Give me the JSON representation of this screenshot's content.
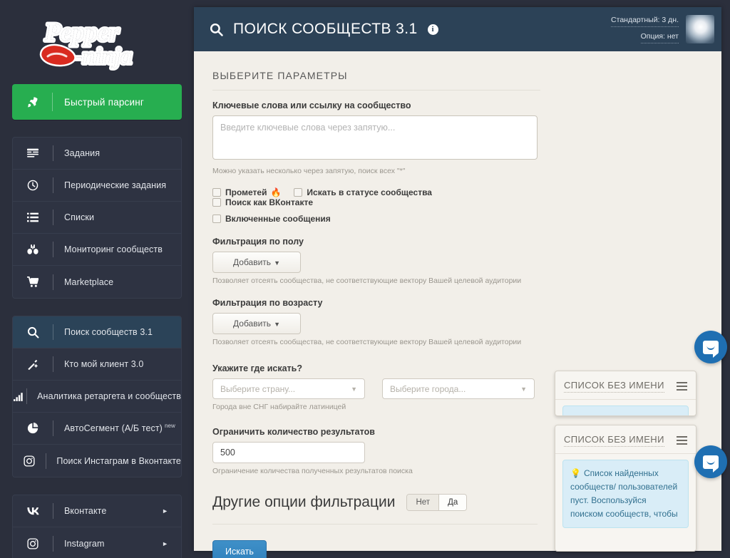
{
  "brand": {
    "logo_line1": "Pepper",
    "logo_line2": "ninja"
  },
  "sidebar": {
    "quick": {
      "label": "Быстрый парсинг",
      "icon": "rocket-icon"
    },
    "group1": [
      {
        "label": "Задания",
        "icon": "tasks-icon"
      },
      {
        "label": "Периодические задания",
        "icon": "clock-icon"
      },
      {
        "label": "Списки",
        "icon": "list-icon"
      },
      {
        "label": "Мониторинг сообществ",
        "icon": "binoculars-icon"
      },
      {
        "label": "Marketplace",
        "icon": "cart-icon"
      }
    ],
    "group2": [
      {
        "label": "Поиск сообществ 3.1",
        "icon": "search-icon",
        "active": true
      },
      {
        "label": "Кто мой клиент 3.0",
        "icon": "magic-wand-icon"
      },
      {
        "label": "Аналитика ретаргета и сообществ",
        "icon": "bar-chart-icon"
      },
      {
        "label": "АвтоСегмент (А/Б тест)",
        "sup": "new",
        "icon": "pie-chart-icon"
      },
      {
        "label": "Поиск Инстаграм в Вконтакте",
        "icon": "instagram-icon"
      }
    ],
    "group3": [
      {
        "label": "Вконтакте",
        "icon": "vk-icon",
        "caret": "►"
      },
      {
        "label": "Instagram",
        "icon": "instagram-icon",
        "caret": "►"
      }
    ]
  },
  "header": {
    "search_icon": "search-icon",
    "title": "ПОИСК СООБЩЕСТВ 3.1",
    "info_icon": "info-icon",
    "plan": "Стандартный: 3 дн.",
    "option": "Опция: нет"
  },
  "form": {
    "section_title": "ВЫБЕРИТЕ ПАРАМЕТРЫ",
    "keywords": {
      "label": "Ключевые слова или ссылку на сообщество",
      "value": "",
      "placeholder": "Введите ключевые слова через запятую...",
      "hint": "Можно указать несколько через запятую, поиск всех \"*\""
    },
    "checkboxes": [
      {
        "label": "Прометей",
        "checked": false,
        "badge": "🔥"
      },
      {
        "label": "Искать в статусе сообщества",
        "checked": false
      },
      {
        "label": "Поиск как ВКонтакте",
        "checked": false
      },
      {
        "label": "Включенные сообщения",
        "checked": false
      }
    ],
    "gender": {
      "label": "Фильтрация по полу",
      "button": "Добавить",
      "hint": "Позволяет отсеять сообщества, не соответствующие вектору Вашей целевой аудитории"
    },
    "age": {
      "label": "Фильтрация по возрасту",
      "button": "Добавить",
      "hint": "Позволяет отсеять сообщества, не соответствующие вектору Вашей целевой аудитории"
    },
    "geo": {
      "label": "Укажите где искать?",
      "country_placeholder": "Выберите страну...",
      "city_placeholder": "Выберите города...",
      "hint": "Города вне СНГ набирайте латиницей"
    },
    "limit": {
      "label": "Ограничить количество результатов",
      "value": "500",
      "hint": "Ограничение количества полученных результатов поиска"
    },
    "other_options": {
      "title": "Другие опции фильтрации",
      "no_label": "Нет",
      "yes_label": "Да",
      "selected": "Нет"
    },
    "submit": "Искать"
  },
  "cards": [
    {
      "title": "СПИСОК БЕЗ ИМЕНИ",
      "menu_icon": "hamburger-icon",
      "notice": ""
    },
    {
      "title": "СПИСОК БЕЗ ИМЕНИ",
      "menu_icon": "hamburger-icon",
      "notice": "Список найденных сообществ/ пользователей пуст. Воспользуйся поиском сообществ, чтобы"
    }
  ],
  "chat": {
    "icon": "chat-bubble-icon"
  },
  "colors": {
    "sidebar_bg": "#2b2f3c",
    "accent_green": "#27ae50",
    "header_blue": "#2c4257",
    "panel_bg": "#f2efe9",
    "primary_button": "#3081bd",
    "notice_bg": "#d9edf7",
    "notice_text": "#31708f"
  }
}
